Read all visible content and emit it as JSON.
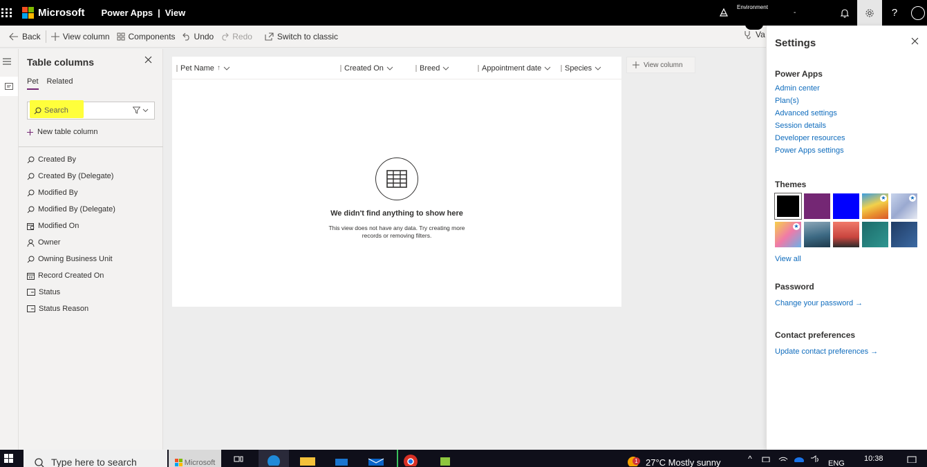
{
  "topbar": {
    "brand": "Microsoft",
    "app_name": "Power Apps",
    "separator": "|",
    "view_name": "View",
    "environment_label": "Environment",
    "environment_value": "-",
    "icons": [
      "waffle-icon",
      "environment-icon",
      "bell-icon",
      "gear-icon",
      "help-icon",
      "avatar"
    ]
  },
  "commands": {
    "back": "Back",
    "view_column": "View column",
    "components": "Components",
    "undo": "Undo",
    "redo": "Redo",
    "switch_classic": "Switch to classic",
    "validate_partial": "Va"
  },
  "panel": {
    "title": "Table columns",
    "tabs": [
      {
        "label": "Pet",
        "active": true
      },
      {
        "label": "Related",
        "active": false
      }
    ],
    "search_placeholder": "Search",
    "new_column": "New table column",
    "columns": [
      {
        "label": "Created By",
        "icon": "lookup-icon"
      },
      {
        "label": "Created By (Delegate)",
        "icon": "lookup-icon"
      },
      {
        "label": "Modified By",
        "icon": "lookup-icon"
      },
      {
        "label": "Modified By (Delegate)",
        "icon": "lookup-icon"
      },
      {
        "label": "Modified On",
        "icon": "calendar-clock-icon"
      },
      {
        "label": "Owner",
        "icon": "person-icon"
      },
      {
        "label": "Owning Business Unit",
        "icon": "lookup-icon"
      },
      {
        "label": "Record Created On",
        "icon": "calendar-icon"
      },
      {
        "label": "Status",
        "icon": "choice-icon"
      },
      {
        "label": "Status Reason",
        "icon": "choice-icon"
      }
    ]
  },
  "grid": {
    "headers": [
      {
        "label": "Pet Name",
        "sorted": "asc"
      },
      {
        "label": "Created On"
      },
      {
        "label": "Breed"
      },
      {
        "label": "Appointment date"
      },
      {
        "label": "Species"
      }
    ],
    "add_column": "View column",
    "empty_title": "We didn't find anything to show here",
    "empty_subtitle": "This view does not have any data. Try creating more records or removing filters."
  },
  "settings": {
    "title": "Settings",
    "power_apps_heading": "Power Apps",
    "links": [
      "Admin center",
      "Plan(s)",
      "Advanced settings",
      "Session details",
      "Developer resources",
      "Power Apps settings"
    ],
    "themes_heading": "Themes",
    "themes": [
      {
        "name": "black",
        "color": "#000000",
        "selected": true,
        "star": false
      },
      {
        "name": "purple",
        "color": "#742774",
        "selected": false,
        "star": false
      },
      {
        "name": "blue",
        "color": "#0000ff",
        "selected": false,
        "star": false
      },
      {
        "name": "rainbow",
        "color": "#e8b33a",
        "selected": false,
        "star": true
      },
      {
        "name": "pastel",
        "color": "#a9b9d8",
        "selected": false,
        "star": true
      },
      {
        "name": "unicorn",
        "color": "#f07aa8",
        "selected": false,
        "star": true
      },
      {
        "name": "mountain",
        "color": "#3d6a84",
        "selected": false,
        "star": false
      },
      {
        "name": "palm",
        "color": "#d9584e",
        "selected": false,
        "star": false
      },
      {
        "name": "circuit-teal",
        "color": "#1c6b6a",
        "selected": false,
        "star": false
      },
      {
        "name": "circuit-blue",
        "color": "#2c4f7c",
        "selected": false,
        "star": false
      }
    ],
    "view_all": "View all",
    "password_heading": "Password",
    "change_password": "Change your password →",
    "contact_heading": "Contact preferences",
    "update_contact": "Update contact preferences →"
  },
  "taskbar": {
    "search_placeholder": "Type here to search",
    "pinned_label": "Microsoft",
    "weather": "27°C  Mostly sunny",
    "badge": "1",
    "language": "ENG",
    "time": "10:38"
  },
  "colors": {
    "accent": "#742774",
    "link": "#0f6cbd",
    "highlight": "#ffff3b"
  }
}
